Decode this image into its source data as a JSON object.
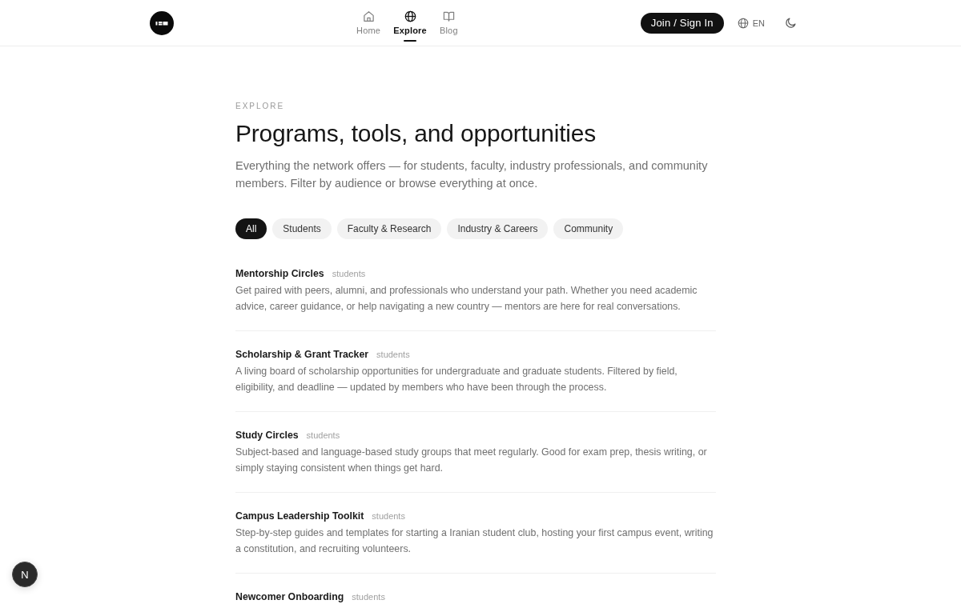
{
  "header": {
    "nav": [
      {
        "label": "Home",
        "selected": false
      },
      {
        "label": "Explore",
        "selected": true
      },
      {
        "label": "Blog",
        "selected": false
      }
    ],
    "join_button": "Join / Sign In",
    "language": "EN"
  },
  "hero": {
    "eyebrow": "EXPLORE",
    "title": "Programs, tools, and opportunities",
    "description": "Everything the network offers — for students, faculty, industry professionals, and community members. Filter by audience or browse everything at once."
  },
  "filters": [
    {
      "label": "All",
      "selected": true
    },
    {
      "label": "Students",
      "selected": false
    },
    {
      "label": "Faculty & Research",
      "selected": false
    },
    {
      "label": "Industry & Careers",
      "selected": false
    },
    {
      "label": "Community",
      "selected": false
    }
  ],
  "programs": [
    {
      "title": "Mentorship Circles",
      "tag": "students",
      "description": "Get paired with peers, alumni, and professionals who understand your path. Whether you need academic advice, career guidance, or help navigating a new country — mentors are here for real conversations."
    },
    {
      "title": "Scholarship & Grant Tracker",
      "tag": "students",
      "description": "A living board of scholarship opportunities for undergraduate and graduate students. Filtered by field, eligibility, and deadline — updated by members who have been through the process."
    },
    {
      "title": "Study Circles",
      "tag": "students",
      "description": "Subject-based and language-based study groups that meet regularly. Good for exam prep, thesis writing, or simply staying consistent when things get hard."
    },
    {
      "title": "Campus Leadership Toolkit",
      "tag": "students",
      "description": "Step-by-step guides and templates for starting a Iranian student club, hosting your first campus event, writing a constitution, and recruiting volunteers."
    },
    {
      "title": "Newcomer Onboarding",
      "tag": "students"
    }
  ],
  "dev_indicator": "N"
}
